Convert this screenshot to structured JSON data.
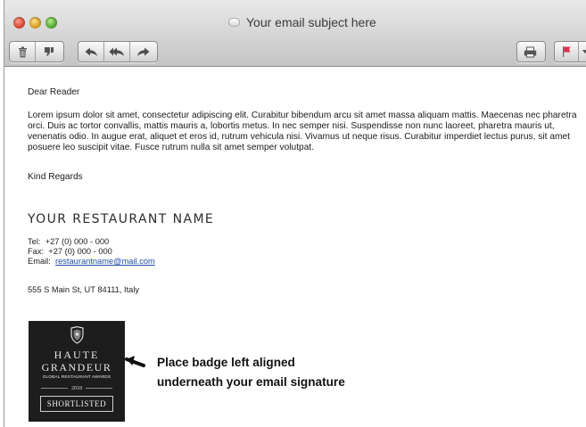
{
  "window": {
    "title": "Your email subject here"
  },
  "toolbar": {
    "left_group": [
      {
        "name": "delete",
        "icon": "trash-icon"
      },
      {
        "name": "junk",
        "icon": "thumbs-down-icon"
      }
    ],
    "reply_group": [
      {
        "name": "reply",
        "icon": "reply-icon"
      },
      {
        "name": "reply-all",
        "icon": "reply-all-icon"
      },
      {
        "name": "forward",
        "icon": "forward-icon"
      }
    ],
    "right_group": [
      {
        "name": "print",
        "icon": "printer-icon"
      }
    ],
    "flag_group": [
      {
        "name": "flag",
        "icon": "flag-icon",
        "menu_icon": "chevron-down-icon"
      }
    ]
  },
  "email": {
    "greeting": "Dear Reader",
    "body": "Lorem ipsum dolor sit amet, consectetur adipiscing elit. Curabitur bibendum arcu sit amet massa aliquam mattis. Maecenas nec pharetra orci. Duis ac tortor convallis, mattis mauris a, lobortis metus. In nec semper nisi. Suspendisse non nunc laoreet, pharetra mauris ut, venenatis odio. In augue erat, aliquet et eros id, rutrum vehicula nisi. Vivamus ut neque risus. Curabitur imperdiet lectus purus, sit amet posuere leo suscipit vitae. Fusce rutrum nulla sit amet semper volutpat.",
    "closing": "Kind Regards"
  },
  "signature": {
    "restaurant_name": "YOUR RESTAURANT NAME",
    "tel_label": "Tel:",
    "tel_value": "+27 (0) 000 - 000",
    "fax_label": "Fax:",
    "fax_value": "+27 (0) 000 - 000",
    "email_label": "Email:",
    "email_value": "restaurantname@mail.com",
    "address": "555 S Main St, UT 84111, Italy"
  },
  "badge": {
    "line1": "HAUTE",
    "line2": "GRANDEUR",
    "line3": "GLOBAL RESTAURANT AWARDS",
    "year": "2018",
    "status": "SHORTLISTED",
    "emblem": "crest-icon"
  },
  "instruction": {
    "line1": "Place badge left aligned",
    "line2": "underneath your email signature",
    "arrow": "arrow-icon"
  },
  "colors": {
    "link": "#1f4fa6",
    "badge_background": "#1d1d1d",
    "toolbar": "#c4c4c4",
    "flag": "#e0314f"
  }
}
